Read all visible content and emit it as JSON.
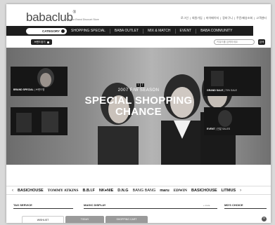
{
  "header": {
    "logo": "babaclub",
    "logo_tagline": "Fashion Brand Discount Store",
    "util_links": [
      "로그인",
      "회원가입",
      "마이페이지",
      "장바구니",
      "주문/배송조회",
      "고객센터"
    ]
  },
  "nav": {
    "category_label": "CATEGORY",
    "items": [
      "SHOPPING SPECIAL",
      "BABA OUTLET",
      "MIX & MATCH",
      "EVENT",
      "BABA COMMUNITY"
    ]
  },
  "subbar": {
    "brand_button": "브랜드찾기",
    "search_placeholder": "키워드를 입력하세요",
    "search_button": "검색"
  },
  "hero": {
    "season": "2007 F/W SEASON",
    "title_line1": "SPECIAL SHOPPING",
    "title_line2": "CHANCE",
    "pager": [
      "1",
      "2"
    ],
    "thumbs": [
      {
        "label_bold": "BRAND SPECIAL",
        "label_rest": "| 브랜드명"
      },
      {
        "label_bold": "",
        "label_rest": ""
      },
      {
        "label_bold": "GRAND SALE",
        "label_rest": "| 70% SALE"
      },
      {
        "label_bold": "EVENT",
        "label_rest": "| 연말 SALES"
      }
    ]
  },
  "brands": {
    "prev": "‹",
    "next": "›",
    "items": [
      "BASICHOUSE",
      "TOMMY ATKINS",
      "B.B.I.F",
      "NK●NIE",
      "D.N.G",
      "BANG BANG",
      "maru",
      "EDWIN",
      "BASICHOUSE",
      "LITMUS"
    ]
  },
  "sections": {
    "tag_service": "TAG SERVICE",
    "magic_display": "MAGIC DISPLAY",
    "more": "+ more",
    "mds_choice": "MD'S CHOICE"
  },
  "tabs": [
    "WISHLIST",
    "TODAY",
    "SHOPPING CART"
  ],
  "close": "×"
}
